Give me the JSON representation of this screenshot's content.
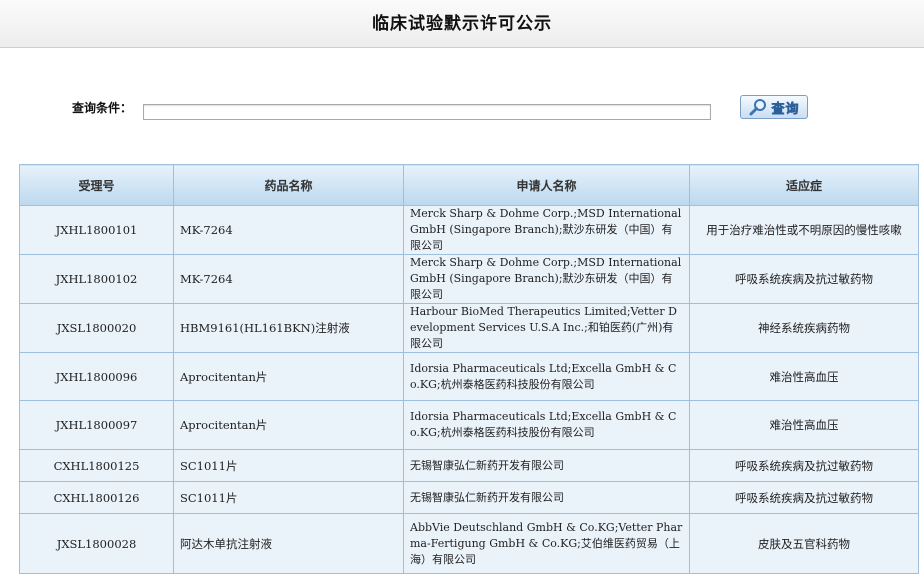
{
  "header": {
    "title": "临床试验默示许可公示"
  },
  "search": {
    "label": "查询条件：",
    "value": "",
    "button_label": "查询"
  },
  "table": {
    "columns": [
      "受理号",
      "药品名称",
      "申请人名称",
      "适应症"
    ],
    "rows": [
      {
        "id": "JXHL1800101",
        "drug": "MK-7264",
        "applicant": "Merck Sharp & Dohme Corp.;MSD International GmbH (Singapore Branch);默沙东研发（中国）有限公司",
        "indication": "用于治疗难治性或不明原因的慢性咳嗽"
      },
      {
        "id": "JXHL1800102",
        "drug": "MK-7264",
        "applicant": "Merck Sharp & Dohme Corp.;MSD International GmbH (Singapore Branch);默沙东研发（中国）有限公司",
        "indication": "呼吸系统疾病及抗过敏药物"
      },
      {
        "id": "JXSL1800020",
        "drug": "HBM9161(HL161BKN)注射液",
        "applicant": "Harbour BioMed Therapeutics Limited;Vetter Development Services U.S.A Inc.;和铂医药(广州)有限公司",
        "indication": "神经系统疾病药物"
      },
      {
        "id": "JXHL1800096",
        "drug": "Aprocitentan片",
        "applicant": "Idorsia Pharmaceuticals Ltd;Excella GmbH & Co.KG;杭州泰格医药科技股份有限公司",
        "indication": "难治性高血压"
      },
      {
        "id": "JXHL1800097",
        "drug": "Aprocitentan片",
        "applicant": "Idorsia Pharmaceuticals Ltd;Excella GmbH & Co.KG;杭州泰格医药科技股份有限公司",
        "indication": "难治性高血压"
      },
      {
        "id": "CXHL1800125",
        "drug": "SC1011片",
        "applicant": "无锡智康弘仁新药开发有限公司",
        "indication": "呼吸系统疾病及抗过敏药物"
      },
      {
        "id": "CXHL1800126",
        "drug": "SC1011片",
        "applicant": "无锡智康弘仁新药开发有限公司",
        "indication": "呼吸系统疾病及抗过敏药物"
      },
      {
        "id": "JXSL1800028",
        "drug": "阿达木单抗注射液",
        "applicant": "AbbVie Deutschland GmbH & Co.KG;Vetter Pharma-Fertigung GmbH & Co.KG;艾伯维医药贸易（上海）有限公司",
        "indication": "皮肤及五官科药物"
      }
    ]
  },
  "colors": {
    "header_bg": "#efefef",
    "table_border": "#9fc0dd",
    "table_header_bg": "#c9e0f2",
    "row_bg": "#eaf2fa",
    "button_text": "#2a5f9a"
  }
}
